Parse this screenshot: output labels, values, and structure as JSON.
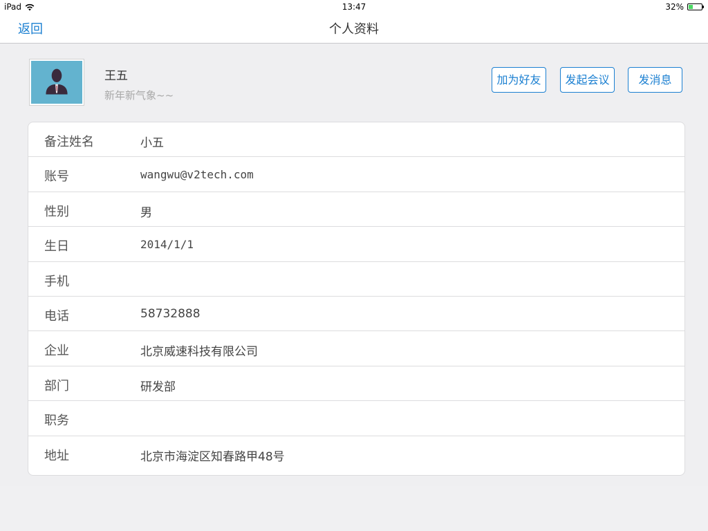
{
  "status_bar": {
    "device": "iPad",
    "time": "13:47",
    "battery": "32%",
    "battery_level": 0.32,
    "icons": [
      "wifi-icon",
      "battery-icon"
    ]
  },
  "nav": {
    "back_label": "返回",
    "title": "个人资料"
  },
  "profile": {
    "name": "王五",
    "signature": "新年新气象~~",
    "avatar_icon": "person-silhouette-icon",
    "avatar_bg": "#63b3cf"
  },
  "actions": {
    "add_friend": "加为好友",
    "start_meeting": "发起会议",
    "send_message": "发消息"
  },
  "info": {
    "rows": [
      {
        "label": "备注姓名",
        "value": "小五"
      },
      {
        "label": "账号",
        "value": "wangwu@v2tech.com"
      },
      {
        "label": "性别",
        "value": "男"
      },
      {
        "label": "生日",
        "value": "2014/1/1"
      },
      {
        "label": "手机",
        "value": ""
      },
      {
        "label": "电话",
        "value": "58732888"
      },
      {
        "label": "企业",
        "value": "北京威速科技有限公司"
      },
      {
        "label": "部门",
        "value": "研发部"
      },
      {
        "label": "职务",
        "value": ""
      },
      {
        "label": "地址",
        "value": "北京市海淀区知春路甲48号"
      }
    ]
  },
  "colors": {
    "accent": "#1a7fd1",
    "background": "#efeff1",
    "battery_fill": "#4cd964"
  }
}
